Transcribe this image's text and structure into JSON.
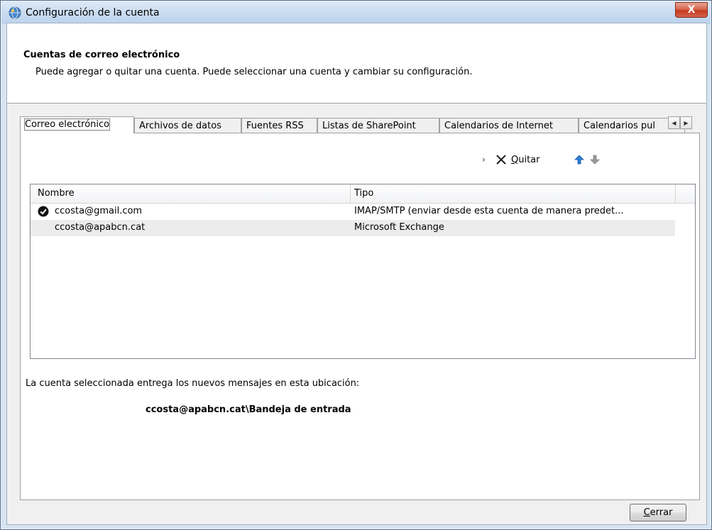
{
  "window": {
    "title": "Configuración de la cuenta",
    "close_glyph": "X"
  },
  "header": {
    "title": "Cuentas de correo electrónico",
    "subtitle": "Puede agregar o quitar una cuenta. Puede seleccionar una cuenta y cambiar su configuración."
  },
  "tabs": [
    {
      "label": "Correo electrónico"
    },
    {
      "label": "Archivos de datos"
    },
    {
      "label": "Fuentes RSS"
    },
    {
      "label": "Listas de SharePoint"
    },
    {
      "label": "Calendarios de Internet"
    },
    {
      "label": "Calendarios pul"
    }
  ],
  "toolbar": {
    "fragment": "›",
    "remove_label_accel": "Q",
    "remove_label_rest": "uitar"
  },
  "list": {
    "columns": {
      "name": "Nombre",
      "type": "Tipo"
    },
    "rows": [
      {
        "name": "ccosta@gmail.com",
        "type": "IMAP/SMTP (enviar desde esta cuenta de manera predet...",
        "is_default": true
      },
      {
        "name": "ccosta@apabcn.cat",
        "type": "Microsoft Exchange",
        "is_default": false
      }
    ]
  },
  "delivery": {
    "label": "La cuenta seleccionada entrega los nuevos mensajes en esta ubicación:",
    "location": "ccosta@apabcn.cat\\Bandeja de entrada"
  },
  "footer": {
    "close_accel": "C",
    "close_rest": "errar"
  },
  "colors": {
    "accent_arrow": "#2e7bd6",
    "disabled_arrow": "#9a9a9a"
  }
}
